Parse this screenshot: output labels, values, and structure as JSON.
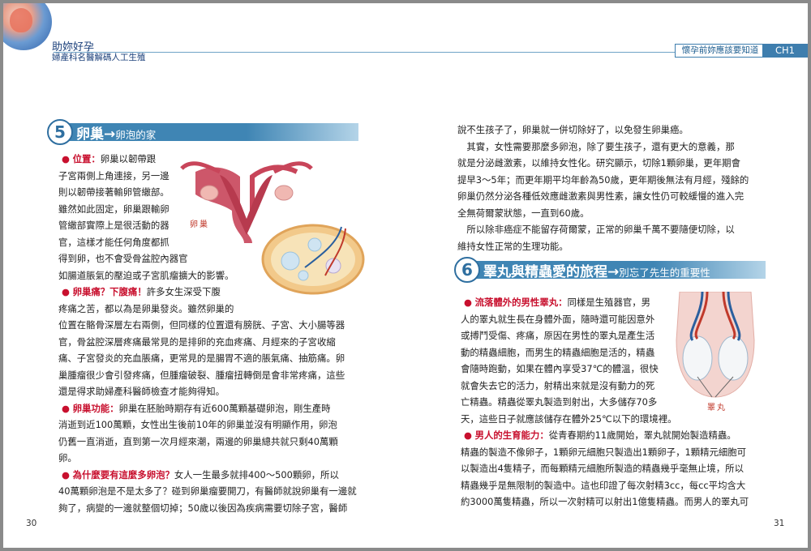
{
  "header": {
    "book_title": "助妳好孕",
    "book_subtitle": "婦產科名醫解碼人工生殖",
    "chapter_label": "懷孕前妳應該要知道",
    "chapter_tag": "CH1"
  },
  "left_page": {
    "page_number": "30",
    "section": {
      "number": "5",
      "title": "卵巢→",
      "subtitle": "卵泡的家"
    },
    "illustration_label": "卵巢",
    "lines": [
      {
        "kw": "位置：",
        "text": "卵巢以韌帶跟"
      },
      {
        "text": "子宮兩側上角連接，另一邊"
      },
      {
        "text": "則以韌帶接著輸卵管繖部。"
      },
      {
        "text": "雖然如此固定，卵巢跟輸卵"
      },
      {
        "text": "管繖部實際上是很活動的器"
      },
      {
        "text": "官，這樣才能任何角度都抓"
      },
      {
        "text": "得到卵，也不會受骨盆腔內器官"
      },
      {
        "text": "如腸道脹氣的壓迫或子宮肌瘤擴大的影響。"
      },
      {
        "kw": "卵巢痛？下腹痛！",
        "text": "許多女生深受下腹"
      },
      {
        "text": "疼痛之苦，都以為是卵巢發炎。雖然卵巢的"
      },
      {
        "text": "位置在骼骨深層左右兩側，但同樣的位置還有膀胱、子宮、大小腸等器"
      },
      {
        "text": "官，骨盆腔深層疼痛最常見的是排卵的充血疼痛、月經來的子宮收縮"
      },
      {
        "text": "痛、子宮發炎的充血脹痛，更常見的是腸胃不適的脹氣痛、抽筋痛。卵"
      },
      {
        "text": "巢腫瘤很少會引發疼痛，但腫瘤破裂、腫瘤扭轉倒是會非常疼痛，這些"
      },
      {
        "text": "還是得求助婦產科醫師檢查才能夠得知。"
      },
      {
        "kw": "卵巢功能：",
        "text": "卵巢在胚胎時期存有近600萬顆基礎卵泡，剛生產時"
      },
      {
        "text": "消逝到近100萬顆，女性出生後前10年的卵巢並沒有明顯作用，卵泡"
      },
      {
        "text": "仍舊一直消逝，直到第一次月經來潮，兩邊的卵巢總共就只剩40萬顆"
      },
      {
        "text": "卵。"
      },
      {
        "kw": "為什麼要有這麼多卵泡？",
        "text": "女人一生最多就排400～500顆卵，所以"
      },
      {
        "text": "40萬顆卵泡是不是太多了？碰到卵巢瘤要開刀，有醫師就說卵巢有一邊就"
      },
      {
        "text": "夠了，病變的一邊就整個切掉；50歲以後因為疾病需要切除子宮，醫師"
      }
    ]
  },
  "right_page": {
    "page_number": "31",
    "top_lines": [
      "說不生孩子了，卵巢就一併切除好了，以免發生卵巢癌。",
      "　其實，女性需要那麼多卵泡，除了要生孩子，還有更大的意義，那",
      "就是分泌雌激素，以維持女性化。研究顯示，切除1顆卵巢，更年期會",
      "提早3～5年；而更年期平均年齡為50歲，更年期後無法有月經，殘餘的",
      "卵巢仍然分泌各種低效應雌激素與男性素，讓女性仍可較緩慢的進入完",
      "全無荷爾蒙狀態，一直到60歲。",
      "　所以除非癌症不能留存荷爾蒙，正常的卵巢千萬不要隨便切除，以",
      "維持女性正常的生理功能。"
    ],
    "section": {
      "number": "6",
      "title": "睪丸與精蟲愛的旅程→",
      "subtitle": "別忘了先生的重要性"
    },
    "illustration_label": "睪丸",
    "lines": [
      {
        "kw": "流落體外的男性睪丸：",
        "text": "同樣是生殖器官，男"
      },
      {
        "text": "人的睪丸就生長在身體外面，隨時還可能因意外"
      },
      {
        "text": "或搏鬥受傷、疼痛，原因在男性的睪丸是產生活"
      },
      {
        "text": "動的精蟲細胞，而男生的精蟲細胞是活的，精蟲"
      },
      {
        "text": "會隨時跑動，如果在體內享受37℃的體溫，很快"
      },
      {
        "text": "就會失去它的活力，射精出來就是沒有動力的死"
      },
      {
        "text": "亡精蟲。精蟲從睪丸製造到射出，大多儲存70多"
      },
      {
        "text": "天，這些日子就應該儲存在體外25℃以下的環境裡。"
      },
      {
        "kw": "男人的生育能力：",
        "text": "從青春期約11歲開始，睪丸就開始製造精蟲。"
      },
      {
        "text": "精蟲的製造不像卵子，1顆卵元細胞只製造出1顆卵子，1顆精元細胞可"
      },
      {
        "text": "以製造出4隻精子，而每顆精元細胞所製造的精蟲幾乎毫無止境，所以"
      },
      {
        "text": "精蟲幾乎是無限制的製造中。這也印證了每次射精3cc，每cc平均含大"
      },
      {
        "text": "約3000萬隻精蟲，所以一次射精可以射出1億隻精蟲。而男人的睪丸可"
      }
    ]
  }
}
